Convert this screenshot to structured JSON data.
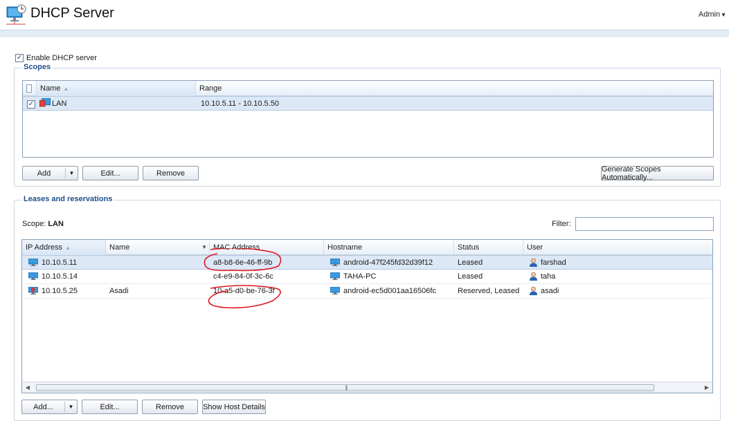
{
  "header": {
    "title": "DHCP Server",
    "user_menu": "Admin"
  },
  "enable": {
    "label": "Enable DHCP server",
    "checked": true
  },
  "scopes": {
    "title": "Scopes",
    "columns": [
      "Name",
      "Range"
    ],
    "rows": [
      {
        "name": "LAN",
        "range": "10.10.5.11 - 10.10.5.50",
        "checked": true
      }
    ],
    "buttons": {
      "add": "Add",
      "edit": "Edit...",
      "remove": "Remove",
      "generate": "Generate Scopes Automatically..."
    }
  },
  "leases": {
    "title": "Leases and reservations",
    "scope_prefix": "Scope:",
    "scope_value": "LAN",
    "filter_label": "Filter:",
    "filter_value": "",
    "columns": [
      "IP Address",
      "Name",
      "MAC Address",
      "Hostname",
      "Status",
      "User"
    ],
    "rows": [
      {
        "ip": "10.10.5.11",
        "name": "",
        "mac": "a8-b8-6e-46-ff-9b",
        "hostname": "android-47f245fd32d39f12",
        "status": "Leased",
        "user": "farshad",
        "icon": "computer-icon"
      },
      {
        "ip": "10.10.5.14",
        "name": "",
        "mac": "c4-e9-84-0f-3c-6c",
        "hostname": "TAHA-PC",
        "status": "Leased",
        "user": "taha",
        "icon": "computer-icon"
      },
      {
        "ip": "10.10.5.25",
        "name": "Asadi",
        "mac": "10-a5-d0-be-76-3f",
        "hostname": "android-ec5d001aa16506fc",
        "status": "Reserved, Leased",
        "user": "asadi",
        "icon": "reserved-computer-icon"
      }
    ],
    "buttons": {
      "add": "Add...",
      "edit": "Edit...",
      "remove": "Remove",
      "details": "Show Host Details"
    }
  },
  "colors": {
    "accent": "#1f4e8c",
    "selected_row": "#dde8f6",
    "annotation": "#e0141e"
  }
}
